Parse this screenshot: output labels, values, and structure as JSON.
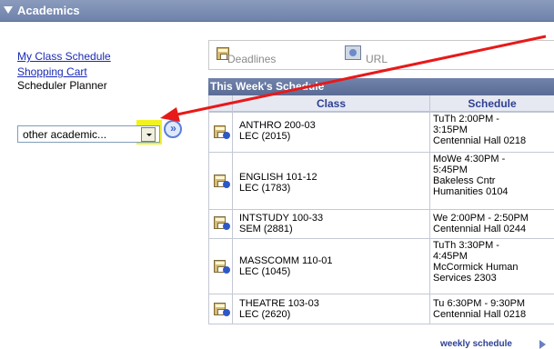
{
  "header": {
    "title": "Academics"
  },
  "nav": {
    "my_class_schedule": "My Class Schedule",
    "shopping_cart": "Shopping Cart",
    "scheduler_planner": "Scheduler Planner"
  },
  "dropdown": {
    "selected": "other academic..."
  },
  "go_button": {
    "label": "»"
  },
  "toolbar": {
    "deadlines_label": "Deadlines",
    "url_label": "URL"
  },
  "schedule": {
    "title": "This Week's Schedule",
    "col_class": "Class",
    "col_schedule": "Schedule",
    "rows": [
      {
        "class_name": "ANTHRO 200-03",
        "section": "LEC (2015)",
        "schedule": "TuTh 2:00PM -\n3:15PM\nCentennial Hall 0218"
      },
      {
        "class_name": "ENGLISH 101-12",
        "section": "LEC (1783)",
        "schedule": "MoWe 4:30PM -\n5:45PM\nBakeless Cntr\nHumanities 0104"
      },
      {
        "class_name": "INTSTUDY 100-33",
        "section": "SEM (2881)",
        "schedule": "We 2:00PM - 2:50PM\nCentennial Hall 0244"
      },
      {
        "class_name": "MASSCOMM 110-01",
        "section": "LEC (1045)",
        "schedule": "TuTh 3:30PM -\n4:45PM\nMcCormick Human\nServices 2303"
      },
      {
        "class_name": "THEATRE 103-03",
        "section": "LEC (2620)",
        "schedule": "Tu 6:30PM - 9:30PM\nCentennial Hall 0218"
      }
    ]
  },
  "weekly_link": "weekly schedule",
  "colors": {
    "header_bar": "#7587af",
    "link": "#1a2ab5",
    "highlight": "#f2f222",
    "annotation_arrow": "#e81919"
  },
  "icons": [
    "collapse-triangle-icon",
    "dropdown-arrow-icon",
    "go-arrows-icon",
    "calendar-icon",
    "info-dot-icon",
    "url-icon",
    "right-triangle-icon"
  ]
}
